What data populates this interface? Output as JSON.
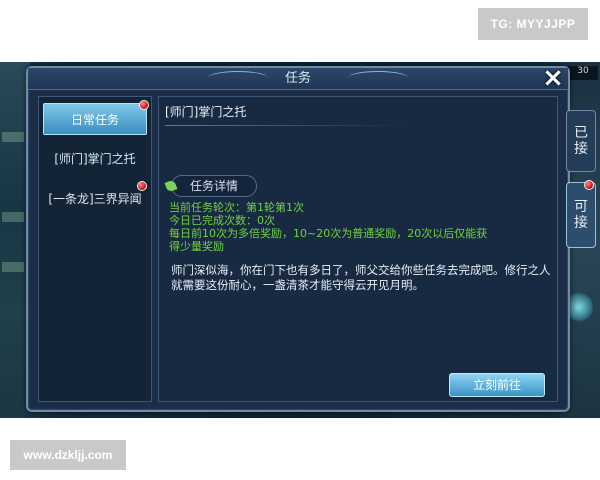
{
  "watermarks": {
    "top": "TG: MYYJJPP",
    "bottom": "www.dzkljj.com"
  },
  "dialog": {
    "title": "任务",
    "close_icon": "close-icon"
  },
  "categories": [
    {
      "label": "日常任务",
      "active": true,
      "has_alert": true
    },
    {
      "label": "[师门]掌门之托",
      "active": false,
      "has_alert": false
    },
    {
      "label": "[一条龙]三界异闻",
      "active": false,
      "has_alert": true
    }
  ],
  "task": {
    "title": "[师门]掌门之托",
    "details_label": "任务详情",
    "lines": [
      "当前任务轮次：第1轮第1次",
      "今日已完成次数：0次",
      "每日前10次为多倍奖励，10~20次为普通奖励，20次以后仅能获",
      "得少量奖励"
    ],
    "description": "师门深似海，你在门下也有多日了，师父交给你些任务去完成吧。修行之人就需要这份耐心，一盏清茶才能守得云开见月明。",
    "go_button": "立刻前往"
  },
  "side_tabs": {
    "accepted": "已接",
    "available": "可接"
  },
  "background": {
    "level_badge": "30"
  },
  "colors": {
    "accent": "#3a8ec0",
    "reward_text": "#6fd23f",
    "alert": "#d01b1b"
  }
}
